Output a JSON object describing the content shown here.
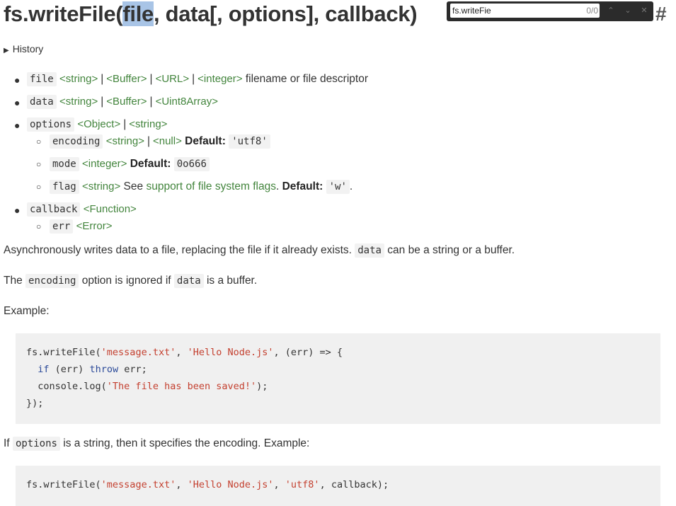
{
  "title": {
    "prefix": "fs.writeFile(",
    "selected": "file",
    "suffix": ", data[, options], callback)"
  },
  "anchor": "#",
  "find": {
    "query": "fs.writeFie",
    "count": "0/0",
    "prev": "⌃",
    "next": "⌄",
    "close": "✕"
  },
  "history": {
    "label": "History",
    "arrow": "▶"
  },
  "params": {
    "file": {
      "name": "file",
      "types": [
        "<string>",
        "<Buffer>",
        "<URL>",
        "<integer>"
      ],
      "desc": "filename or file descriptor"
    },
    "data": {
      "name": "data",
      "types": [
        "<string>",
        "<Buffer>",
        "<Uint8Array>"
      ]
    },
    "options": {
      "name": "options",
      "types": [
        "<Object>",
        "<string>"
      ],
      "encoding": {
        "name": "encoding",
        "types": [
          "<string>",
          "<null>"
        ],
        "default_label": "Default:",
        "default": "'utf8'"
      },
      "mode": {
        "name": "mode",
        "types": [
          "<integer>"
        ],
        "default_label": "Default:",
        "default": "0o666"
      },
      "flag": {
        "name": "flag",
        "types": [
          "<string>"
        ],
        "see": "See",
        "link": "support of file system flags",
        "dot": ".",
        "default_label": "Default:",
        "default": "'w'",
        "end": "."
      }
    },
    "callback": {
      "name": "callback",
      "types": [
        "<Function>"
      ],
      "err": {
        "name": "err",
        "types": [
          "<Error>"
        ]
      }
    }
  },
  "paragraphs": {
    "p1": {
      "text": "Asynchronously writes data to a file, replacing the file if it already exists.",
      "code": "data",
      "after": "can be a string or a buffer."
    },
    "p2": {
      "before": "The",
      "code1": "encoding",
      "mid": "option is ignored if",
      "code2": "data",
      "after": "is a buffer."
    },
    "p3": {
      "text": "Example:"
    },
    "p4": {
      "before": "If",
      "code": "options",
      "after": "is a string, then it specifies the encoding. Example:"
    }
  },
  "code1": {
    "l1": {
      "a": "fs.writeFile(",
      "s1": "'message.txt'",
      "b": ", ",
      "s2": "'Hello Node.js'",
      "c": ", (err) => {"
    },
    "l2": {
      "indent": "  ",
      "kw1": "if",
      "a": " (err) ",
      "kw2": "throw",
      "b": " err;"
    },
    "l3": {
      "a": "  console.log(",
      "s": "'The file has been saved!'",
      "b": ");"
    },
    "l4": {
      "a": "});"
    }
  },
  "code2": {
    "l1": {
      "a": "fs.writeFile(",
      "s1": "'message.txt'",
      "b": ", ",
      "s2": "'Hello Node.js'",
      "c": ", ",
      "s3": "'utf8'",
      "d": ", callback);"
    }
  }
}
